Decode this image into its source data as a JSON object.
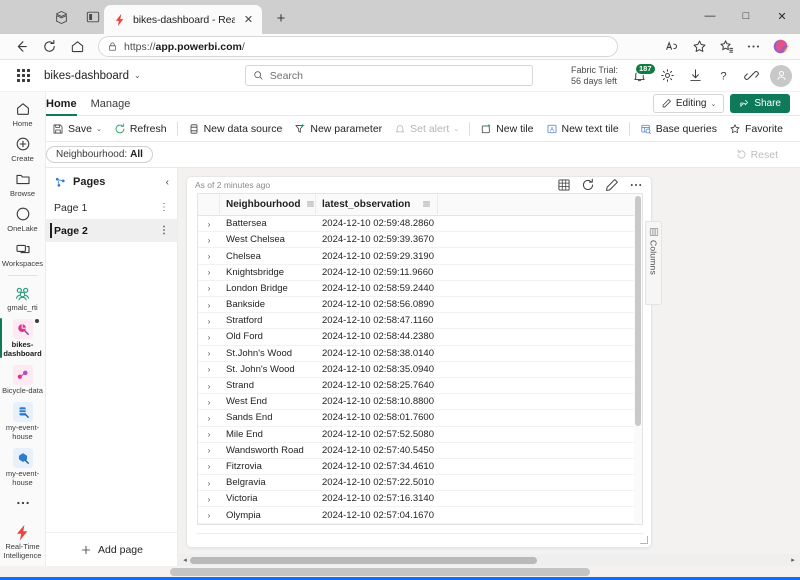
{
  "browser": {
    "tab": {
      "title": "bikes-dashboard - Real-Time Inte",
      "favicon": "realtime-intelligence-icon",
      "close_label": "✕"
    },
    "new_tab_label": "+",
    "window_controls": {
      "minimize": "—",
      "maximize": "□",
      "close": "✕"
    },
    "nav": {
      "back": "←",
      "refresh": "⟳",
      "home": "⌂"
    },
    "address": {
      "prefix": "https://",
      "domain": "app.powerbi.com",
      "suffix": "/",
      "full": "https://app.powerbi.com/"
    },
    "toolbar_icons": [
      "read-aloud-icon",
      "favorite-star-icon",
      "collections-icon",
      "settings-more-icon",
      "copilot-icon"
    ]
  },
  "fabric": {
    "waffle_label": "app-launcher",
    "app_name": "bikes-dashboard",
    "app_name_chevron": "⌄",
    "search": {
      "placeholder": "Search",
      "icon": "search-icon"
    },
    "trial_line1": "Fabric Trial:",
    "trial_line2": "56 days left",
    "notification_count": "187",
    "icons": [
      "notifications-icon",
      "gear-icon",
      "download-icon",
      "help-icon",
      "feedback-icon"
    ],
    "avatar_label": "account-avatar"
  },
  "ribbon": {
    "tabs": [
      {
        "label": "Home",
        "active": true
      },
      {
        "label": "Manage",
        "active": false
      }
    ],
    "editing_label": "Editing",
    "editing_chevron": "⌄",
    "share_label": "Share"
  },
  "commandbar": {
    "items": [
      {
        "label": "Save",
        "icon": "save-icon",
        "chevron": "⌄",
        "disabled": false
      },
      {
        "label": "Refresh",
        "icon": "refresh-icon",
        "disabled": false
      },
      {
        "label": "New data source",
        "icon": "database-icon",
        "disabled": false
      },
      {
        "label": "New parameter",
        "icon": "parameter-icon",
        "disabled": false
      },
      {
        "label": "Set alert",
        "icon": "alert-icon",
        "chevron": "⌄",
        "disabled": true
      },
      {
        "label": "New tile",
        "icon": "new-tile-icon",
        "disabled": false
      },
      {
        "label": "New text tile",
        "icon": "new-text-tile-icon",
        "disabled": false
      },
      {
        "label": "Base queries",
        "icon": "base-queries-icon",
        "disabled": false
      },
      {
        "label": "Favorite",
        "icon": "favorite-star-icon",
        "disabled": false
      }
    ]
  },
  "filterbar": {
    "pill_label": "Neighbourhood:",
    "pill_value": "All",
    "reset_label": "Reset",
    "reset_icon": "reset-icon"
  },
  "rail": {
    "items": [
      {
        "label": "Home",
        "icon": "home-icon",
        "selected": false
      },
      {
        "label": "Create",
        "icon": "create-plus-icon",
        "selected": false
      },
      {
        "label": "Browse",
        "icon": "browse-folder-icon",
        "selected": false
      },
      {
        "label": "OneLake",
        "icon": "onelake-icon",
        "selected": false
      },
      {
        "label": "Workspaces",
        "icon": "workspaces-icon",
        "selected": false
      },
      {
        "label": "gmalc_rti",
        "icon": "workspace-group-icon",
        "selected": false
      },
      {
        "label": "bikes-dashboard",
        "icon": "dashboard-item-icon",
        "selected": true
      },
      {
        "label": "Bicycle-data",
        "icon": "eventstream-item-icon",
        "selected": false
      },
      {
        "label": "my-event-house",
        "icon": "eventhouse-item-icon",
        "selected": false
      },
      {
        "label": "my-event-house",
        "icon": "eventhouse-db-icon",
        "selected": false
      },
      {
        "label": "",
        "icon": "more-ellipsis-icon",
        "selected": false
      }
    ],
    "bottom": {
      "label": "Real-Time Intelligence",
      "icon": "realtime-intelligence-icon"
    }
  },
  "pages": {
    "title": "Pages",
    "icon": "pages-icon",
    "collapse_icon": "‹",
    "items": [
      {
        "label": "Page 1",
        "active": false,
        "more": "⋮"
      },
      {
        "label": "Page 2",
        "active": true,
        "more": "⋮"
      }
    ],
    "add_page_label": "Add page",
    "add_page_icon": "plus-icon"
  },
  "tile": {
    "timestamp": "As of 2 minutes ago",
    "actions": [
      "visual-type-icon",
      "refresh-icon",
      "edit-pencil-icon",
      "more-ellipsis-icon"
    ],
    "columns_panel_label": "Columns",
    "columns_panel_icon": "columns-icon",
    "table": {
      "columns": [
        {
          "label": "Neighbourhood",
          "menu_icon": "column-menu-icon"
        },
        {
          "label": "latest_observation",
          "menu_icon": "column-menu-icon"
        }
      ],
      "expander_glyph": "›",
      "rows": [
        {
          "Neighbourhood": "Battersea",
          "latest_observation": "2024-12-10 02:59:48.2860"
        },
        {
          "Neighbourhood": "West Chelsea",
          "latest_observation": "2024-12-10 02:59:39.3670"
        },
        {
          "Neighbourhood": "Chelsea",
          "latest_observation": "2024-12-10 02:59:29.3190"
        },
        {
          "Neighbourhood": "Knightsbridge",
          "latest_observation": "2024-12-10 02:59:11.9660"
        },
        {
          "Neighbourhood": "London Bridge",
          "latest_observation": "2024-12-10 02:58:59.2440"
        },
        {
          "Neighbourhood": "Bankside",
          "latest_observation": "2024-12-10 02:58:56.0890"
        },
        {
          "Neighbourhood": "Stratford",
          "latest_observation": "2024-12-10 02:58:47.1160"
        },
        {
          "Neighbourhood": "Old Ford",
          "latest_observation": "2024-12-10 02:58:44.2380"
        },
        {
          "Neighbourhood": "St.John's Wood",
          "latest_observation": "2024-12-10 02:58:38.0140"
        },
        {
          "Neighbourhood": "St. John's Wood",
          "latest_observation": "2024-12-10 02:58:35.0940"
        },
        {
          "Neighbourhood": "Strand",
          "latest_observation": "2024-12-10 02:58:25.7640"
        },
        {
          "Neighbourhood": "West End",
          "latest_observation": "2024-12-10 02:58:10.8800"
        },
        {
          "Neighbourhood": "Sands End",
          "latest_observation": "2024-12-10 02:58:01.7600"
        },
        {
          "Neighbourhood": "Mile End",
          "latest_observation": "2024-12-10 02:57:52.5080"
        },
        {
          "Neighbourhood": "Wandsworth Road",
          "latest_observation": "2024-12-10 02:57:40.5450"
        },
        {
          "Neighbourhood": "Fitzrovia",
          "latest_observation": "2024-12-10 02:57:34.4610"
        },
        {
          "Neighbourhood": "Belgravia",
          "latest_observation": "2024-12-10 02:57:22.5010"
        },
        {
          "Neighbourhood": "Victoria",
          "latest_observation": "2024-12-10 02:57:16.3140"
        },
        {
          "Neighbourhood": "Olympia",
          "latest_observation": "2024-12-10 02:57:04.1670"
        }
      ]
    }
  },
  "scrollbars": {
    "left_arrow": "◂",
    "right_arrow": "▸"
  },
  "colors": {
    "accent_green": "#0f7a5a",
    "badge_green": "#107c41",
    "selection_bar": "#1f1f1f",
    "taskbar_blue": "#0d6efd"
  }
}
